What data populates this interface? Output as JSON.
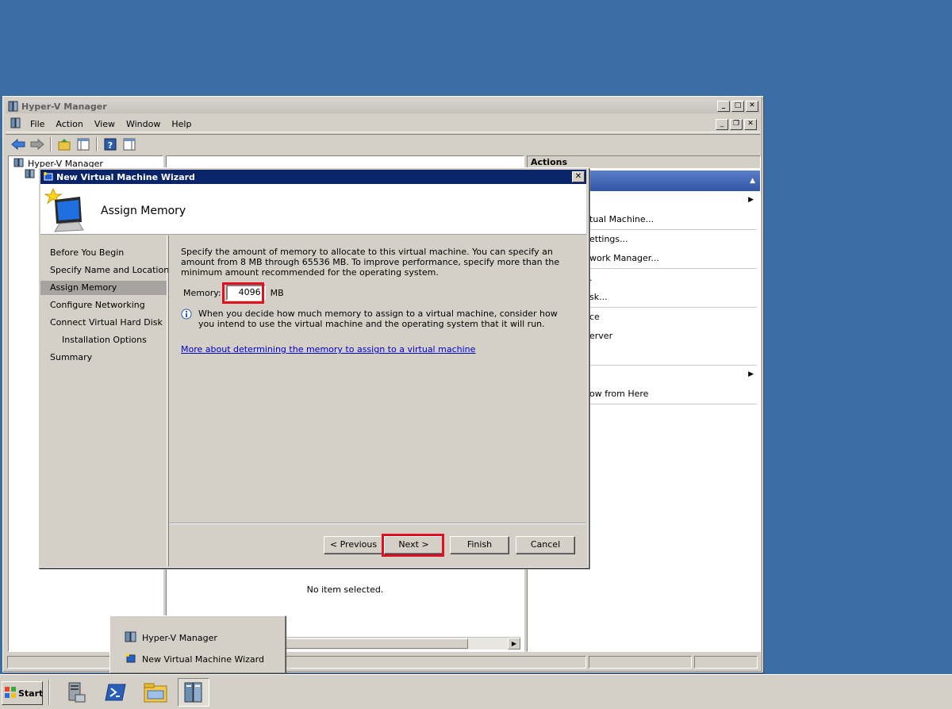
{
  "main_window": {
    "title": "Hyper-V Manager",
    "menu": [
      "File",
      "Action",
      "View",
      "Window",
      "Help"
    ],
    "tree_root": "Hyper-V Manager",
    "center_empty_text": "No item selected.",
    "actions_header": "Actions",
    "actions_items": [
      "tual Machine...",
      "ettings...",
      "work Manager...",
      ".",
      "sk...",
      "ce",
      "erver",
      "ow from Here"
    ]
  },
  "wizard": {
    "title": "New Virtual Machine Wizard",
    "page_title": "Assign Memory",
    "steps": [
      {
        "label": "Before You Begin"
      },
      {
        "label": "Specify Name and Location"
      },
      {
        "label": "Assign Memory",
        "active": true
      },
      {
        "label": "Configure Networking"
      },
      {
        "label": "Connect Virtual Hard Disk"
      },
      {
        "label": "Installation Options",
        "sub": true
      },
      {
        "label": "Summary"
      }
    ],
    "description": "Specify the amount of memory to allocate to this virtual machine. You can specify an amount from 8 MB through 65536 MB. To improve performance, specify more than the minimum amount recommended for the operating system.",
    "memory_label": "Memory:",
    "memory_value": "4096",
    "memory_unit": "MB",
    "info_text": "When you decide how much memory to assign to a virtual machine, consider how you intend to use the virtual machine and the operating system that it will run.",
    "link_text": "More about determining the memory to assign to a virtual machine",
    "buttons": {
      "previous": "< Previous",
      "next": "Next >",
      "finish": "Finish",
      "cancel": "Cancel"
    }
  },
  "taskbar_popup": {
    "items": [
      "Hyper-V Manager",
      "New Virtual Machine Wizard"
    ]
  },
  "taskbar": {
    "start_label": "Start"
  },
  "colors": {
    "desktop": "#3a6ea5",
    "highlight": "#e01020",
    "title_active": "#0a246a"
  }
}
